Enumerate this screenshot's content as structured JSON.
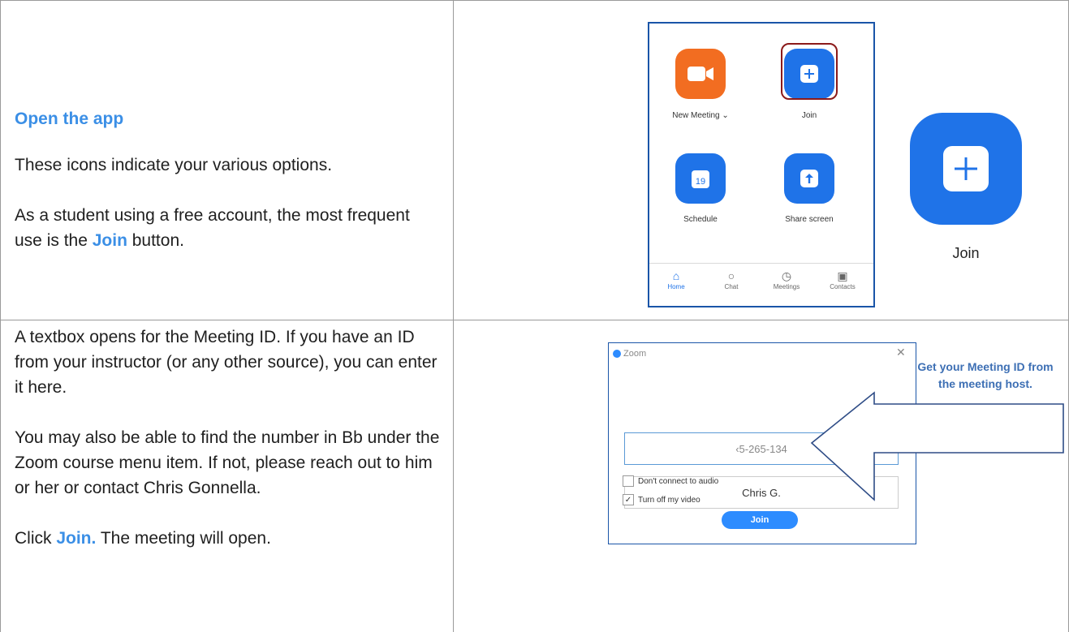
{
  "row1": {
    "heading": "Open the app",
    "para1": "These icons indicate your various options.",
    "para2_before": "As a student using a free account, the most frequent use is the ",
    "para2_join": "Join",
    "para2_after": " button."
  },
  "app": {
    "new_meeting": "New Meeting",
    "join": "Join",
    "schedule": "Schedule",
    "schedule_day": "19",
    "share_screen": "Share screen",
    "tabs": [
      "Home",
      "Chat",
      "Meetings",
      "Contacts"
    ],
    "big_join_label": "Join",
    "accent": "#1f73e8",
    "orange": "#f26d21"
  },
  "row2": {
    "para1": "A textbox opens for the Meeting ID. If you have an ID from your instructor (or any other source), you can enter it here.",
    "para2": "You may also be able to find the number in Bb under the Zoom course menu item. If not, please reach out to him or her or contact Chris Gonnella.",
    "para3_before": "Click ",
    "para3_join": "Join.",
    "para3_after": " The meeting will open."
  },
  "dialog": {
    "title": "Zoom",
    "meeting_id": "‹5-265-134",
    "name": "Chris G.",
    "opt_audio": "Don't connect to audio",
    "opt_video": "Turn off my video",
    "join": "Join"
  },
  "callout": "Get your Meeting ID from the meeting host."
}
